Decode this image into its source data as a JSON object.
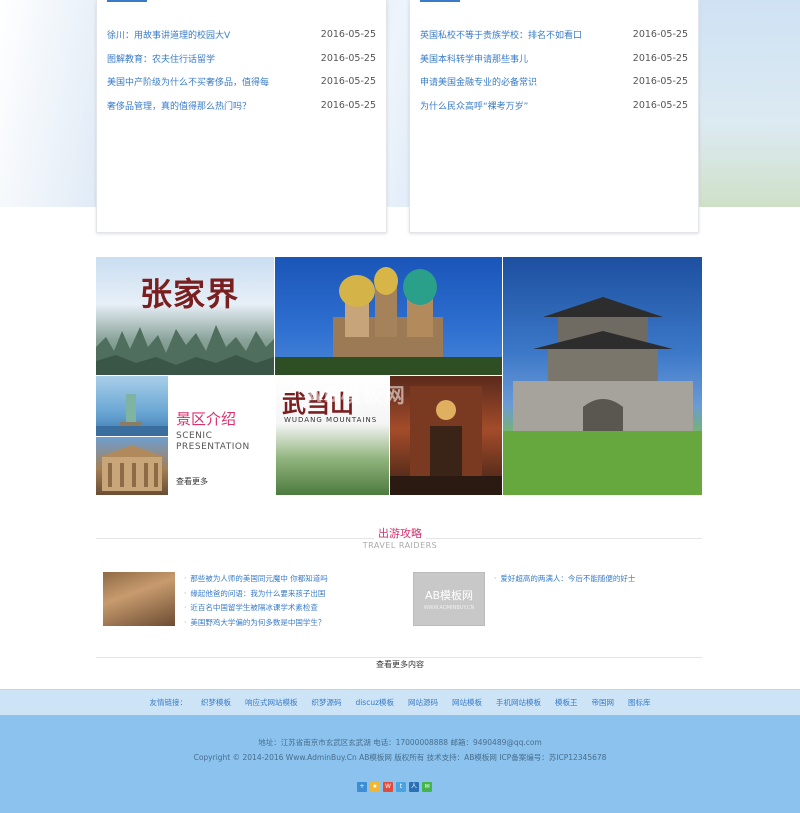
{
  "news_left": [
    {
      "title": "徐川：用故事讲道理的校园大V",
      "date": "2016-05-25"
    },
    {
      "title": "图解教育：农夫住行话留学",
      "date": "2016-05-25"
    },
    {
      "title": "美国中产阶级为什么不买奢侈品，值得每",
      "date": "2016-05-25"
    },
    {
      "title": "奢侈品管理，真的值得那么热门吗？",
      "date": "2016-05-25"
    }
  ],
  "news_right": [
    {
      "title": "英国私校不等于贵族学校：排名不如看口",
      "date": "2016-05-25"
    },
    {
      "title": "美国本科转学申请那些事儿",
      "date": "2016-05-25"
    },
    {
      "title": "申请美国金融专业的必备常识",
      "date": "2016-05-25"
    },
    {
      "title": "为什么民众高呼“裸考万岁”",
      "date": "2016-05-25"
    }
  ],
  "gallery": {
    "zjj_title": "张家界",
    "scenic_cn": "景区介绍",
    "scenic_en_1": "SCENIC",
    "scenic_en_2": "PRESENTATION",
    "scenic_more": "查看更多",
    "wds_title": "武当山",
    "wds_sub": "WUDANG MOUNTAINS",
    "watermark": "AB模板网"
  },
  "travel": {
    "title_cn": "出游攻略",
    "title_en": "TRAVEL RAIDERS",
    "left_items": [
      "那些被为人师的美国同元魔中 你都知道吗",
      "缘起他爸的问语：我为什么要来孩子出国",
      "近百名中国留学生被隔冰课学术素检查",
      "美国野鸡大学偏的为何多数是中国学生？"
    ],
    "right_items": [
      "爱好超高的两满人：今后不能随便的好士"
    ],
    "thumb2_text": "AB模板网",
    "thumb2_sub": "WWW.ADMINBUY.CN"
  },
  "more_content": "查看更多内容",
  "links": {
    "label": "友情链接：",
    "items": [
      "织梦模板",
      "响应式网站模板",
      "织梦源码",
      "discuz模板",
      "网站源码",
      "网站模板",
      "手机网站模板",
      "模板王",
      "帝国网",
      "图标库"
    ]
  },
  "footer": {
    "line1": "地址：江苏省南京市玄武区玄武湖    电话：17000008888    邮箱：9490489@qq.com",
    "line2": "Copyright © 2014-2016 Www.AdminBuy.Cn AB模板网 版权所有    技术支持：AB模板网    ICP备案编号：苏ICP12345678"
  },
  "share_icons": [
    "plus-icon",
    "qzone-icon",
    "weibo-icon",
    "tencent-weibo-icon",
    "renren-icon",
    "wechat-icon"
  ],
  "colors": {
    "link_blue": "#3a7bc8",
    "accent_pink": "#d9306e",
    "links_bar_bg": "#cce4f6",
    "footer_bg": "#8bc3ee"
  }
}
